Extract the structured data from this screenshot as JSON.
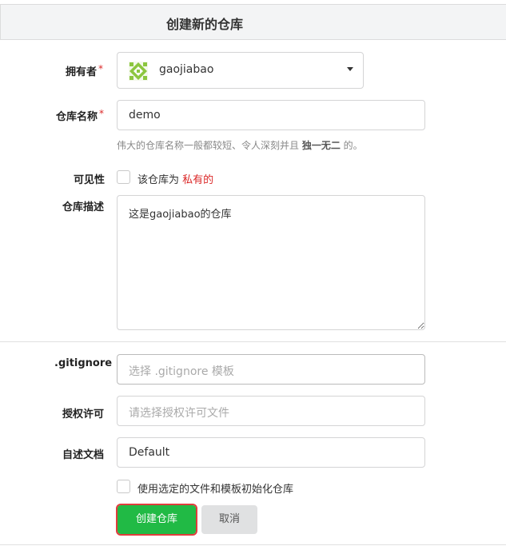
{
  "header": {
    "title": "创建新的仓库"
  },
  "form": {
    "owner": {
      "label": "拥有者",
      "required_mark": "*",
      "value": "gaojiabao"
    },
    "repo_name": {
      "label": "仓库名称",
      "required_mark": "*",
      "value": "demo",
      "help_prefix": "伟大的仓库名称一般都较短、令人深刻并且 ",
      "help_bold": "独一无二",
      "help_suffix": " 的。"
    },
    "visibility": {
      "label": "可见性",
      "text_prefix": "该仓库为 ",
      "text_highlight": "私有的",
      "checked": false
    },
    "description": {
      "label": "仓库描述",
      "value": "这是gaojiabao的仓库"
    },
    "gitignore": {
      "label": ".gitignore",
      "placeholder": "选择 .gitignore 模板"
    },
    "license": {
      "label": "授权许可",
      "placeholder": "请选择授权许可文件"
    },
    "readme": {
      "label": "自述文档",
      "value": "Default"
    },
    "init": {
      "label": "使用选定的文件和模板初始化仓库",
      "checked": false
    }
  },
  "actions": {
    "create_label": "创建仓库",
    "cancel_label": "取消"
  },
  "colors": {
    "primary_green": "#21ba45",
    "required_red": "#db2828",
    "avatar_green": "#8cc63f"
  }
}
